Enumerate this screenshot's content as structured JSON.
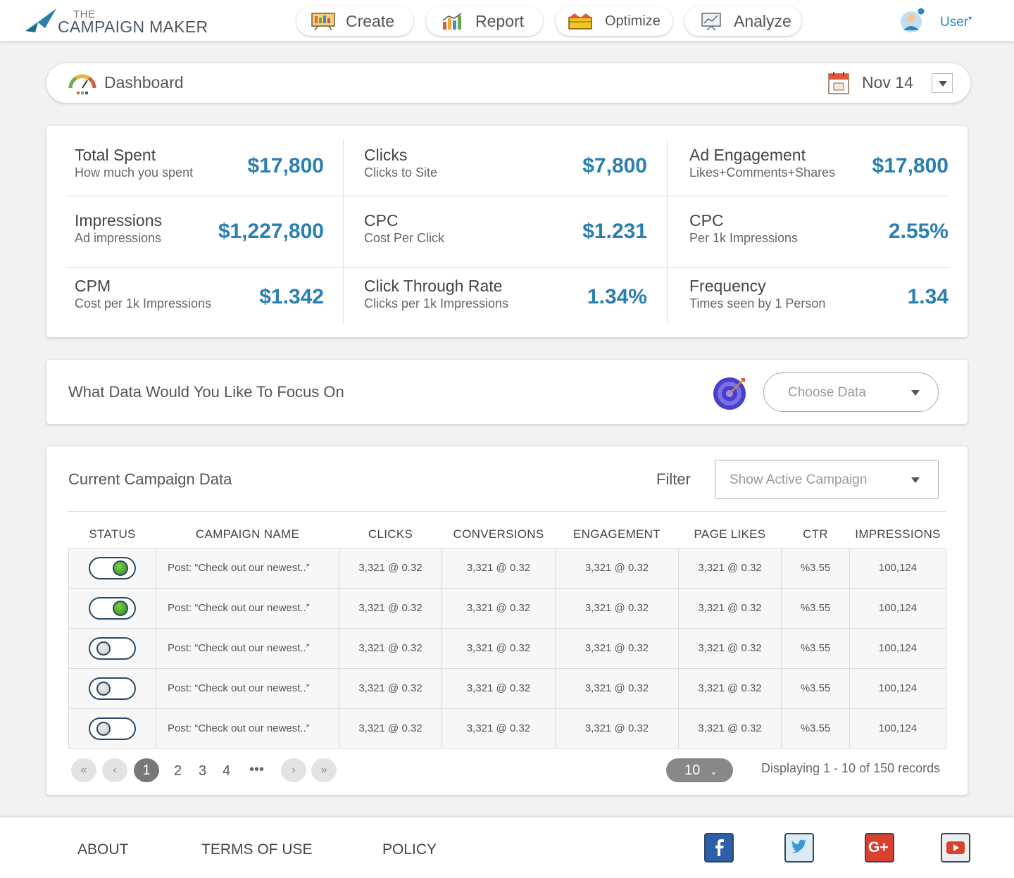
{
  "header": {
    "logo_the": "THE",
    "logo_campaign": "CAMPAIGN",
    "logo_maker": "MAKER",
    "nav": [
      {
        "label": "Create",
        "icon": "easel-icon"
      },
      {
        "label": "Report",
        "icon": "bar-chart-icon"
      },
      {
        "label": "Optimize",
        "icon": "toolbox-icon"
      },
      {
        "label": "Analyze",
        "icon": "presentation-icon"
      }
    ],
    "user_label": "User"
  },
  "dashboard": {
    "title": "Dashboard",
    "date": "Nov 14"
  },
  "metrics": [
    {
      "name": "Total Spent",
      "sub": "How much you spent",
      "value": "$17,800"
    },
    {
      "name": "Clicks",
      "sub": "Clicks to Site",
      "value": "$7,800"
    },
    {
      "name": "Ad Engagement",
      "sub": "Likes+Comments+Shares",
      "value": "$17,800"
    },
    {
      "name": "Impressions",
      "sub": "Ad impressions",
      "value": "$1,227,800"
    },
    {
      "name": "CPC",
      "sub": "Cost Per Click",
      "value": "$1.231"
    },
    {
      "name": "CPC",
      "sub": "Per 1k Impressions",
      "value": "2.55%"
    },
    {
      "name": "CPM",
      "sub": "Cost per 1k Impressions",
      "value": "$1.342"
    },
    {
      "name": "Click Through Rate",
      "sub": "Clicks per 1k Impressions",
      "value": "1.34%"
    },
    {
      "name": "Frequency",
      "sub": "Times seen by 1 Person",
      "value": "1.34"
    }
  ],
  "focus": {
    "question": "What Data Would You Like To Focus On",
    "select_placeholder": "Choose Data"
  },
  "campaign_table": {
    "title": "Current Campaign Data",
    "filter_label": "Filter",
    "filter_placeholder": "Show Active Campaign",
    "columns": [
      "STATUS",
      "CAMPAIGN NAME",
      "CLICKS",
      "CONVERSIONS",
      "ENGAGEMENT",
      "PAGE LIKES",
      "CTR",
      "IMPRESSIONS"
    ],
    "rows": [
      {
        "active": true,
        "name": "Post: “Check out our newest..”",
        "clicks": "3,321 @ 0.32",
        "conversions": "3,321 @ 0.32",
        "engagement": "3,321 @ 0.32",
        "page_likes": "3,321 @ 0.32",
        "ctr": "%3.55",
        "impressions": "100,124"
      },
      {
        "active": true,
        "name": "Post: “Check out our newest..”",
        "clicks": "3,321 @ 0.32",
        "conversions": "3,321 @ 0.32",
        "engagement": "3,321 @ 0.32",
        "page_likes": "3,321 @ 0.32",
        "ctr": "%3.55",
        "impressions": "100,124"
      },
      {
        "active": false,
        "name": "Post: “Check out our newest..”",
        "clicks": "3,321 @ 0.32",
        "conversions": "3,321 @ 0.32",
        "engagement": "3,321 @ 0.32",
        "page_likes": "3,321 @ 0.32",
        "ctr": "%3.55",
        "impressions": "100,124"
      },
      {
        "active": false,
        "name": "Post: “Check out our newest..”",
        "clicks": "3,321 @ 0.32",
        "conversions": "3,321 @ 0.32",
        "engagement": "3,321 @ 0.32",
        "page_likes": "3,321 @ 0.32",
        "ctr": "%3.55",
        "impressions": "100,124"
      },
      {
        "active": false,
        "name": "Post: “Check out our newest..”",
        "clicks": "3,321 @ 0.32",
        "conversions": "3,321 @ 0.32",
        "engagement": "3,321 @ 0.32",
        "page_likes": "3,321 @ 0.32",
        "ctr": "%3.55",
        "impressions": "100,124"
      }
    ],
    "pagination": {
      "first": "«",
      "prev": "‹",
      "pages": [
        "1",
        "2",
        "3",
        "4"
      ],
      "current": "1",
      "ellipsis": "•••",
      "next": "›",
      "last": "»",
      "per_page": "10",
      "info": "Displaying 1 - 10 of 150 records"
    }
  },
  "footer": {
    "links": [
      "ABOUT",
      "TERMS OF USE",
      "POLICY"
    ],
    "social": [
      "facebook-icon",
      "twitter-icon",
      "google-plus-icon",
      "youtube-icon"
    ]
  },
  "colors": {
    "accent_blue": "#2a7fb0",
    "toggle_on_green": "#3a9a1c",
    "toggle_border": "#2b4a66"
  }
}
